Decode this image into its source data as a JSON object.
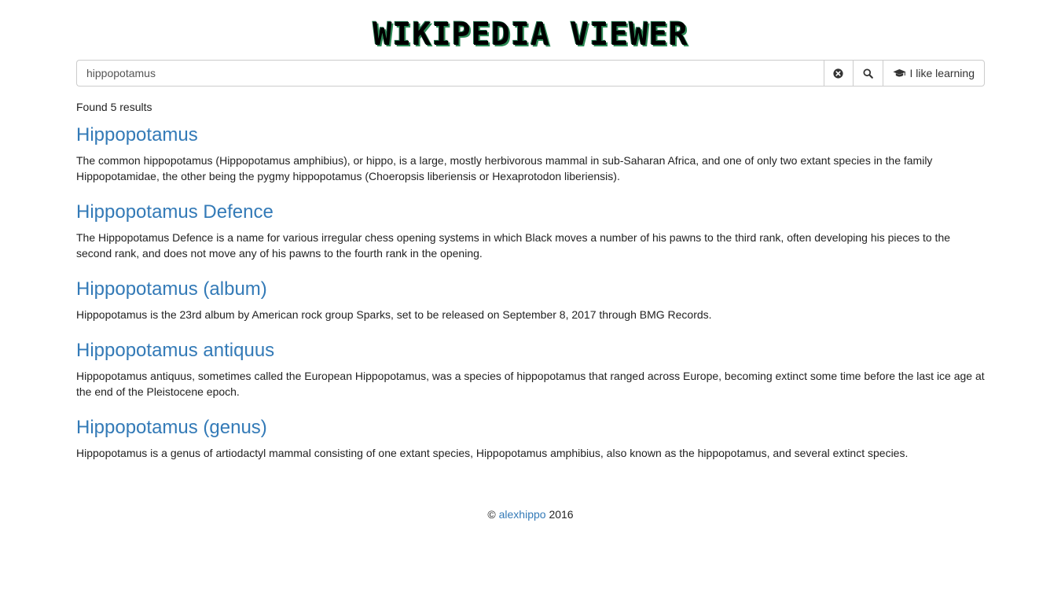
{
  "header": {
    "title": "WIKIPEDIA VIEWER"
  },
  "search": {
    "value": "hippopotamus",
    "clear_icon": "times-circle-icon",
    "search_icon": "search-icon",
    "learn_icon": "graduation-cap-icon",
    "learn_label": "I like learning"
  },
  "status": {
    "found_text": "Found 5 results"
  },
  "results": [
    {
      "title": "Hippopotamus",
      "snippet": "The common hippopotamus (Hippopotamus amphibius), or hippo, is a large, mostly herbivorous mammal in sub-Saharan Africa, and one of only two extant species in the family Hippopotamidae, the other being the pygmy hippopotamus (Choeropsis liberiensis or Hexaprotodon liberiensis)."
    },
    {
      "title": "Hippopotamus Defence",
      "snippet": "The Hippopotamus Defence is a name for various irregular chess opening systems in which Black moves a number of his pawns to the third rank, often developing his pieces to the second rank, and does not move any of his pawns to the fourth rank in the opening."
    },
    {
      "title": "Hippopotamus (album)",
      "snippet": "Hippopotamus is the 23rd album by American rock group Sparks, set to be released on September 8, 2017 through BMG Records."
    },
    {
      "title": "Hippopotamus antiquus",
      "snippet": "Hippopotamus antiquus, sometimes called the European Hippopotamus, was a species of hippopotamus that ranged across Europe, becoming extinct some time before the last ice age at the end of the Pleistocene epoch."
    },
    {
      "title": "Hippopotamus (genus)",
      "snippet": "Hippopotamus is a genus of artiodactyl mammal consisting of one extant species, Hippopotamus amphibius, also known as the hippopotamus, and several extinct species."
    }
  ],
  "footer": {
    "copyright": "©",
    "author": "alexhippo",
    "year": "2016"
  },
  "colors": {
    "link": "#337ab7",
    "title_shadow": "#2e8b57"
  }
}
